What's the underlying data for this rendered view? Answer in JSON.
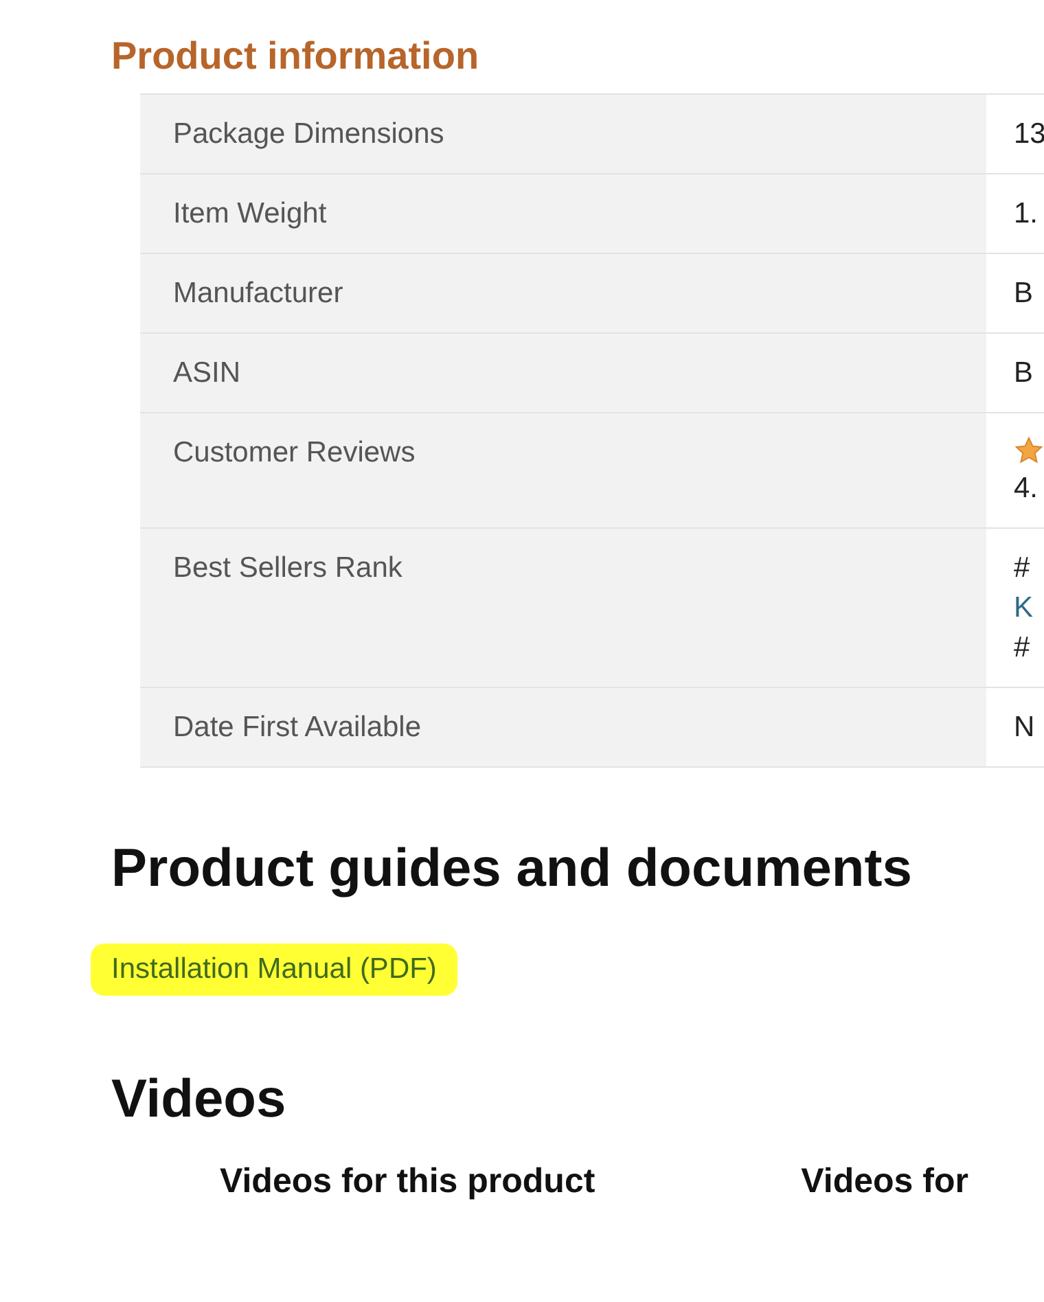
{
  "product_information": {
    "title": "Product information",
    "rows": [
      {
        "label": "Package Dimensions",
        "values": [
          {
            "kind": "text",
            "text": "13"
          }
        ]
      },
      {
        "label": "Item Weight",
        "values": [
          {
            "kind": "text",
            "text": "1."
          }
        ]
      },
      {
        "label": "Manufacturer",
        "values": [
          {
            "kind": "text",
            "text": "B"
          }
        ]
      },
      {
        "label": "ASIN",
        "values": [
          {
            "kind": "text",
            "text": "B"
          }
        ]
      },
      {
        "label": "Customer Reviews",
        "values": [
          {
            "kind": "star"
          },
          {
            "kind": "text",
            "text": "4."
          }
        ]
      },
      {
        "label": "Best Sellers Rank",
        "values": [
          {
            "kind": "text",
            "text": "#"
          },
          {
            "kind": "link",
            "text": "K"
          },
          {
            "kind": "text",
            "text": "#"
          }
        ]
      },
      {
        "label": "Date First Available",
        "values": [
          {
            "kind": "text",
            "text": "N"
          }
        ]
      }
    ]
  },
  "guides": {
    "title": "Product guides and documents",
    "links": [
      {
        "text": "Installation Manual (PDF)",
        "highlighted": true
      }
    ]
  },
  "videos": {
    "title": "Videos",
    "sections": [
      "Videos for this product",
      "Videos for"
    ]
  }
}
